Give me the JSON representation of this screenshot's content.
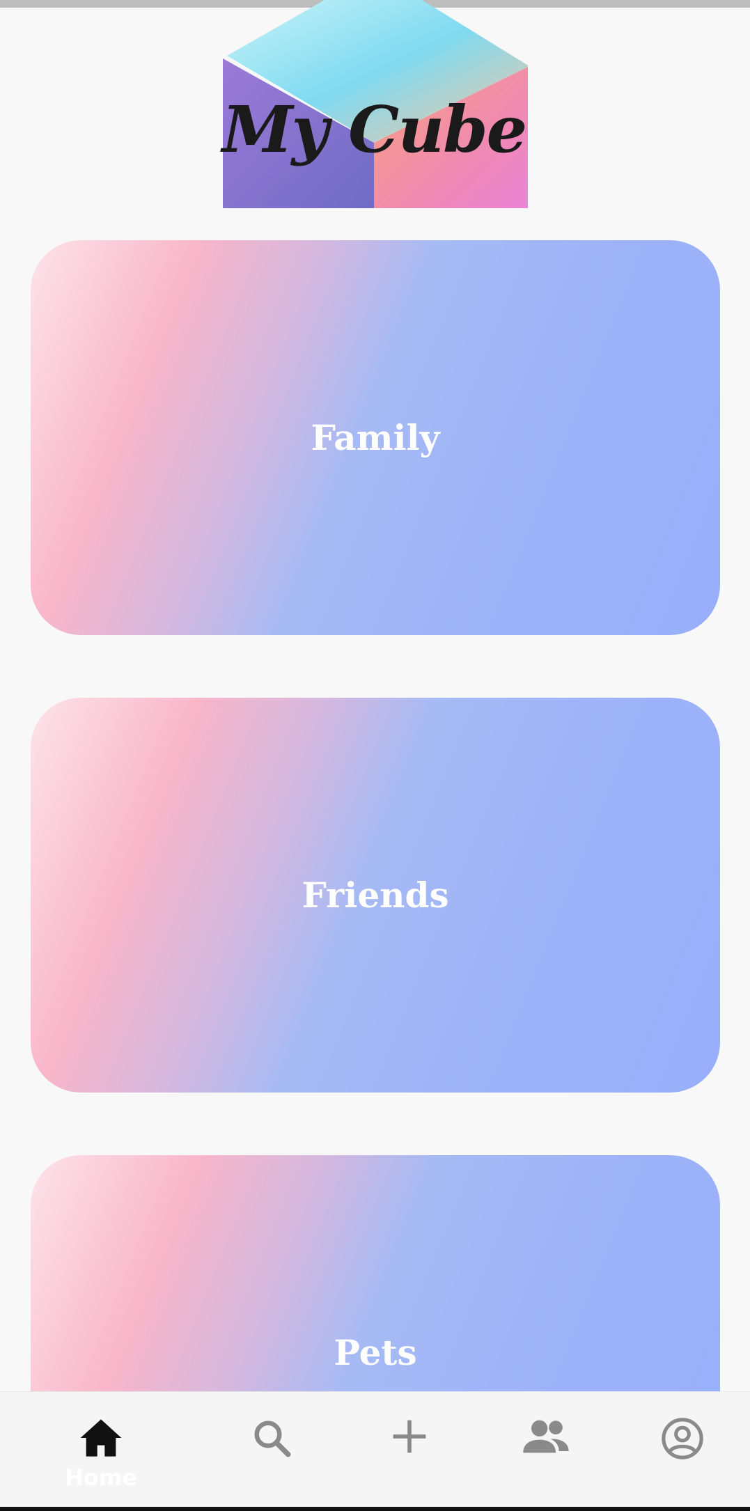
{
  "app": {
    "logo_text": "My Cube"
  },
  "cards": [
    {
      "label": "Family"
    },
    {
      "label": "Friends"
    },
    {
      "label": "Pets"
    }
  ],
  "nav": {
    "items": [
      {
        "icon": "home-icon",
        "label": "Home",
        "active": true
      },
      {
        "icon": "search-icon",
        "active": false
      },
      {
        "icon": "add-icon",
        "active": false
      },
      {
        "icon": "people-icon",
        "active": false
      },
      {
        "icon": "account-icon",
        "active": false
      }
    ],
    "active_color": "#111111",
    "inactive_color": "#8a8a8a"
  },
  "colors": {
    "background": "#f8f8f8",
    "card_gradient": [
      "#fde3ea",
      "#f8b6c9",
      "#a6baf4",
      "#97aefa"
    ]
  }
}
